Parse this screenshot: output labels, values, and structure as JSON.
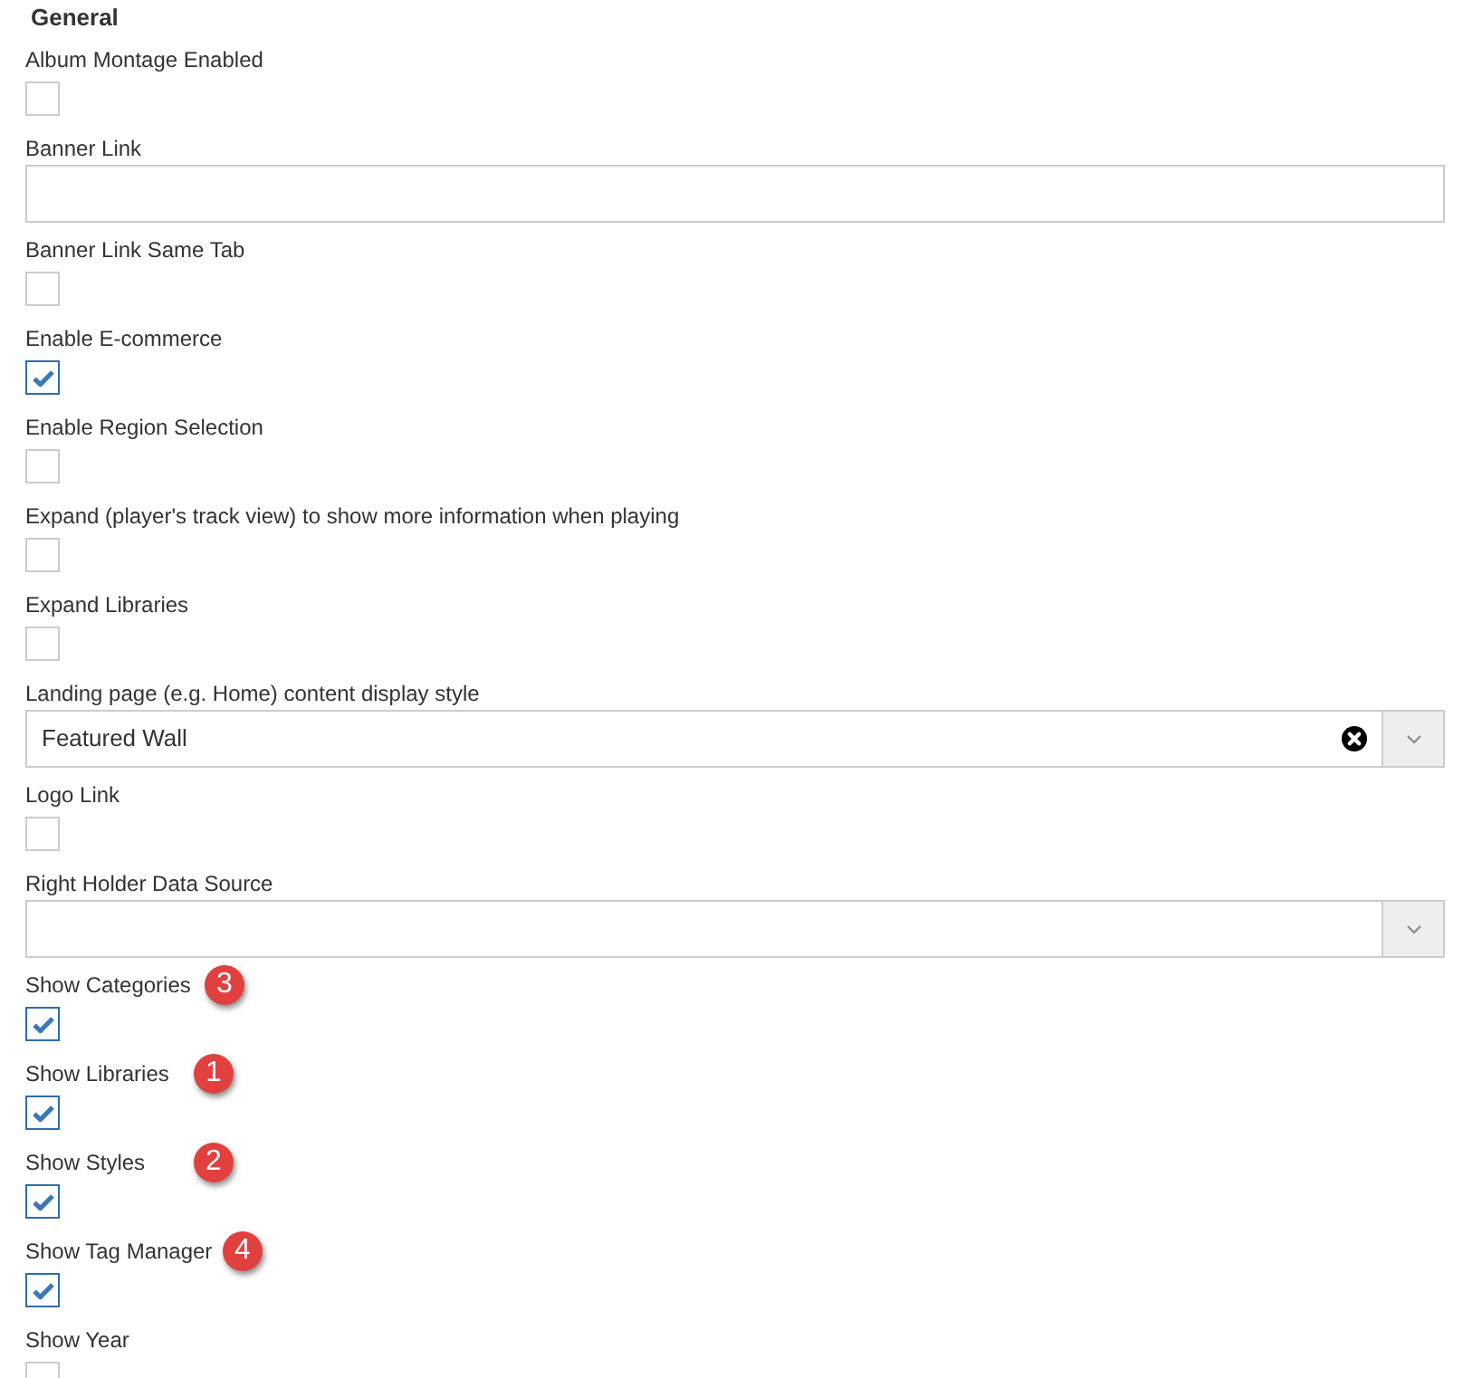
{
  "section": {
    "title": "General"
  },
  "fields": [
    {
      "kind": "checkbox",
      "label": "Album Montage Enabled",
      "checked": false
    },
    {
      "kind": "text",
      "label": "Banner Link"
    },
    {
      "kind": "checkbox",
      "label": "Banner Link Same Tab",
      "checked": false
    },
    {
      "kind": "checkbox",
      "label": "Enable E-commerce",
      "checked": true
    },
    {
      "kind": "checkbox",
      "label": "Enable Region Selection",
      "checked": false
    },
    {
      "kind": "checkbox",
      "label": "Expand (player's track view) to show more information when playing",
      "checked": false
    },
    {
      "kind": "checkbox",
      "label": "Expand Libraries",
      "checked": false
    },
    {
      "kind": "select",
      "label": "Landing page (e.g. Home) content display style",
      "value": "Featured Wall"
    },
    {
      "kind": "checkbox",
      "label": "Logo Link",
      "checked": false
    },
    {
      "kind": "select",
      "label": "Right Holder Data Source"
    },
    {
      "kind": "checkbox",
      "label": "Show Categories",
      "checked": true,
      "badge": "3"
    },
    {
      "kind": "checkbox",
      "label": "Show Libraries",
      "checked": true,
      "badge": "1"
    },
    {
      "kind": "checkbox",
      "label": "Show Styles",
      "checked": true,
      "badge": "2"
    },
    {
      "kind": "checkbox",
      "label": "Show Tag Manager",
      "checked": true,
      "badge": "4"
    },
    {
      "kind": "checkbox",
      "label": "Show Year",
      "checked": false
    }
  ]
}
